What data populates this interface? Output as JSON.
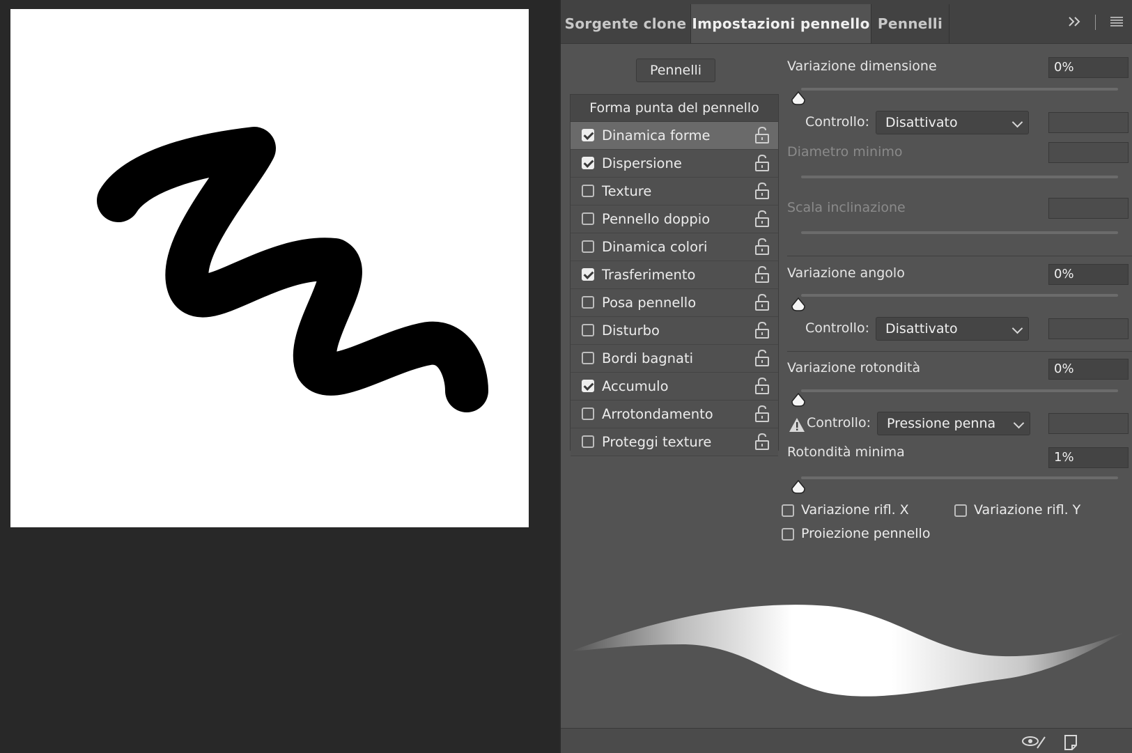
{
  "tabs": [
    {
      "label": "Sorgente clone"
    },
    {
      "label": "Impostazioni pennello"
    },
    {
      "label": "Pennelli"
    }
  ],
  "panel": {
    "brushes_button": "Pennelli",
    "list_header": "Forma punta del pennello",
    "items": [
      {
        "label": "Dinamica forme",
        "checked": true,
        "selected": true
      },
      {
        "label": "Dispersione",
        "checked": true
      },
      {
        "label": "Texture",
        "checked": false
      },
      {
        "label": "Pennello doppio",
        "checked": false
      },
      {
        "label": "Dinamica colori",
        "checked": false
      },
      {
        "label": "Trasferimento",
        "checked": true
      },
      {
        "label": "Posa pennello",
        "checked": false
      },
      {
        "label": "Disturbo",
        "checked": false
      },
      {
        "label": "Bordi bagnati",
        "checked": false
      },
      {
        "label": "Accumulo",
        "checked": true
      },
      {
        "label": "Arrotondamento",
        "checked": false
      },
      {
        "label": "Proteggi texture",
        "checked": false
      }
    ]
  },
  "settings": {
    "size_jitter": {
      "label": "Variazione dimensione",
      "value": "0%"
    },
    "size_control": {
      "label": "Controllo:",
      "value": "Disattivato"
    },
    "min_diameter": {
      "label": "Diametro minimo"
    },
    "tilt_scale": {
      "label": "Scala inclinazione"
    },
    "angle_jitter": {
      "label": "Variazione angolo",
      "value": "0%"
    },
    "angle_control": {
      "label": "Controllo:",
      "value": "Disattivato"
    },
    "roundness_jitter": {
      "label": "Variazione rotondità",
      "value": "0%"
    },
    "roundness_control": {
      "label": "Controllo:",
      "value": "Pressione penna"
    },
    "min_roundness": {
      "label": "Rotondità minima",
      "value": "1%"
    },
    "flip_x": {
      "label": "Variazione rifl. X"
    },
    "flip_y": {
      "label": "Variazione rifl. Y"
    },
    "brush_projection": {
      "label": "Proiezione pennello"
    }
  },
  "icons": {
    "panel_expand": "double-chevron-right-icon",
    "panel_menu": "hamburger-menu-icon",
    "lock": "unlocked-padlock-icon",
    "warning": "warning-triangle-icon",
    "toggle_preview": "eye-brush-icon",
    "new_brush": "new-preset-icon"
  }
}
